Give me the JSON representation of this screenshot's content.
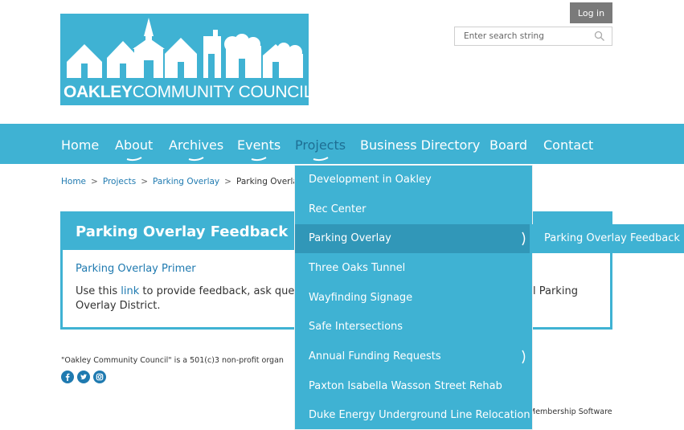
{
  "logo": {
    "text_bold": "OAKLEY",
    "text_light": "COMMUNITY COUNCIL"
  },
  "header": {
    "login_label": "Log in",
    "search_placeholder": "Enter search string",
    "search_value": ""
  },
  "nav": {
    "items": [
      {
        "label": "Home"
      },
      {
        "label": "About"
      },
      {
        "label": "Archives"
      },
      {
        "label": "Events"
      },
      {
        "label": "Projects"
      },
      {
        "label": "Business Directory"
      },
      {
        "label": "Board"
      },
      {
        "label": "Contact"
      }
    ],
    "active": "Projects"
  },
  "breadcrumb": [
    "Home",
    "Projects",
    "Parking Overlay",
    "Parking Overla"
  ],
  "breadcrumb_separator": ">",
  "panel": {
    "title": "Parking Overlay Feedback",
    "primer_link": "Parking Overlay Primer",
    "text_before": "Use this ",
    "text_link": "link",
    "text_after": " to provide feedback, ask questio",
    "text_right": "l Parking",
    "text_line2": "Overlay District."
  },
  "footer": {
    "text": "\"Oakley Community Council\" is a 501(c)3 non-profit organ",
    "membership": "Membership Software",
    "social_icons": [
      "facebook-icon",
      "twitter-icon",
      "instagram-icon"
    ]
  },
  "dropdown": {
    "items": [
      {
        "label": "Development in Oakley"
      },
      {
        "label": "Rec Center"
      },
      {
        "label": "Parking Overlay"
      },
      {
        "label": "Three Oaks Tunnel"
      },
      {
        "label": "Wayfinding Signage"
      },
      {
        "label": "Safe Intersections"
      },
      {
        "label": "Annual Funding Requests"
      },
      {
        "label": "Paxton Isabella Wasson Street Rehab"
      },
      {
        "label": "Duke Energy Underground Line Relocation"
      }
    ],
    "submenu_label": "Parking Overlay Feedback"
  },
  "colors": {
    "brand": "#3fb2d3",
    "brand_dark": "#3197b8",
    "link": "#1f7ab0",
    "button_gray": "#7a7a7a"
  }
}
